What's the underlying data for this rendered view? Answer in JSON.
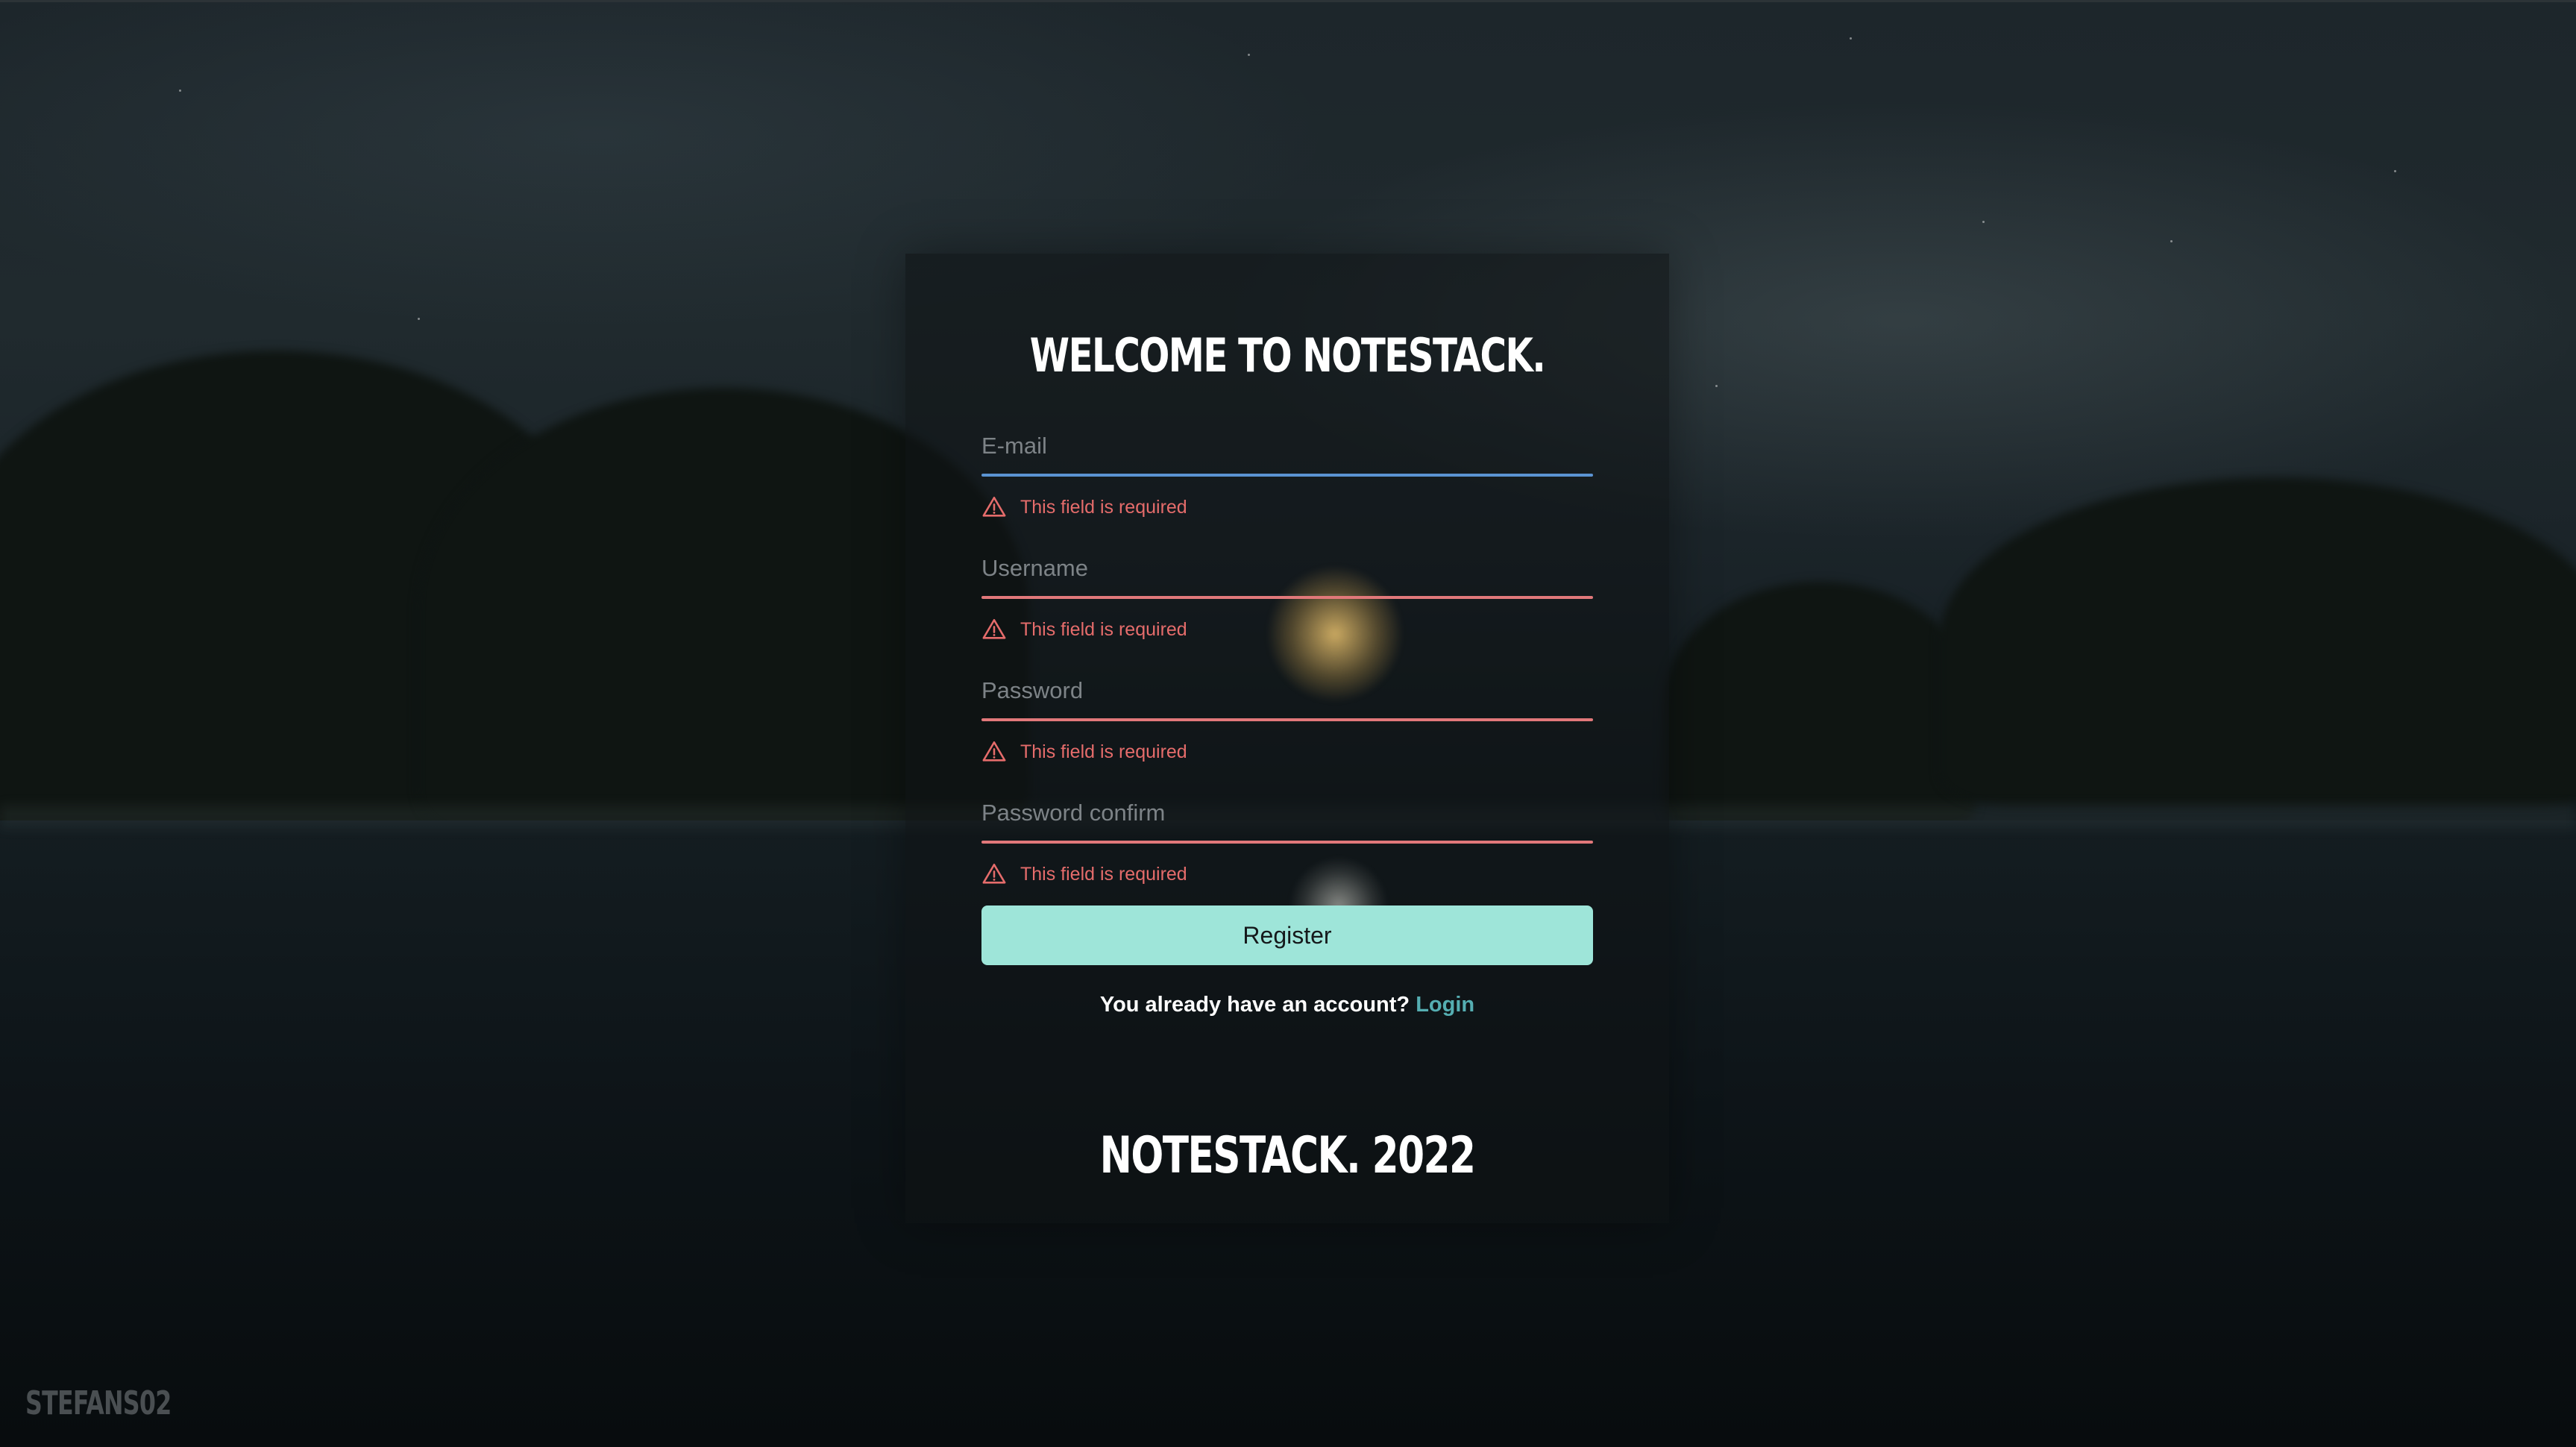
{
  "header": {
    "title": "WELCOME TO NOTESTACK."
  },
  "form": {
    "email": {
      "placeholder": "E-mail",
      "value": "",
      "state": "focused",
      "error": "This field is required"
    },
    "username": {
      "placeholder": "Username",
      "value": "",
      "state": "error",
      "error": "This field is required"
    },
    "password": {
      "placeholder": "Password",
      "value": "",
      "state": "error",
      "error": "This field is required"
    },
    "password_confirm": {
      "placeholder": "Password confirm",
      "value": "",
      "state": "error",
      "error": "This field is required"
    },
    "submit_label": "Register"
  },
  "account_prompt": {
    "text": "You already have an account?",
    "link_label": "Login"
  },
  "footer": {
    "text": "NOTESTACK. 2022"
  },
  "credit": {
    "text": "STEFANS02"
  },
  "icons": {
    "error": "warning-triangle-icon"
  },
  "colors": {
    "accent_button": "#9ee5d9",
    "link": "#55aeb2",
    "error": "#e1787a",
    "focus_underline": "#5b94d3"
  }
}
